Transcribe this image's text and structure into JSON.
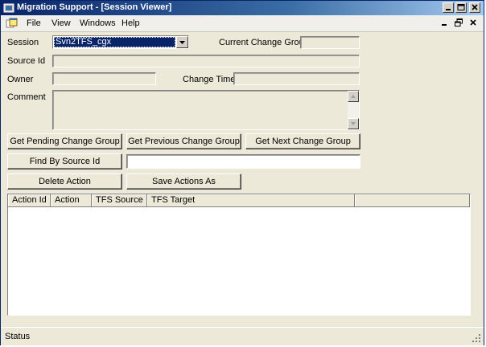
{
  "window": {
    "title": "Migration Support - [Session Viewer]"
  },
  "menu": {
    "items": [
      "File",
      "View",
      "Windows",
      "Help"
    ]
  },
  "form": {
    "session_label": "Session",
    "session_value": "Svn2TFS_cgx",
    "current_change_group_label": "Current Change Group",
    "current_change_group_value": "",
    "source_id_label": "Source Id",
    "source_id_value": "",
    "owner_label": "Owner",
    "owner_value": "",
    "change_time_label": "Change Time",
    "change_time_value": "",
    "comment_label": "Comment",
    "comment_value": ""
  },
  "buttons": {
    "get_pending": "Get Pending Change Group",
    "get_previous": "Get Previous Change Group",
    "get_next": "Get Next Change Group",
    "find_by_source": "Find By Source Id",
    "delete_action": "Delete Action",
    "save_actions": "Save Actions As"
  },
  "find_input_value": "",
  "grid": {
    "columns": [
      "Action Id",
      "Action",
      "TFS Source",
      "TFS Target"
    ],
    "rows": []
  },
  "status": {
    "text": "Status"
  }
}
